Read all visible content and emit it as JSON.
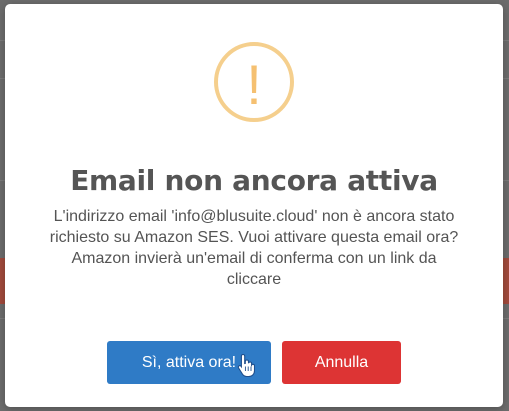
{
  "dialog": {
    "icon": "exclamation-icon",
    "icon_glyph": "!",
    "title": "Email non ancora attiva",
    "message_lines": [
      "L'indirizzo email 'info@blusuite.cloud' non è ancora stato",
      "richiesto su Amazon SES. Vuoi attivare questa email ora?",
      "Amazon invierà un'email di conferma con un link da",
      "cliccare"
    ],
    "confirm_label": "Sì, attiva ora!",
    "cancel_label": "Annulla"
  },
  "colors": {
    "warning": "#f5cf8d",
    "confirm": "#2f7bc6",
    "cancel": "#dd3434",
    "title": "#555555"
  },
  "cursor": "hand-pointer-icon"
}
